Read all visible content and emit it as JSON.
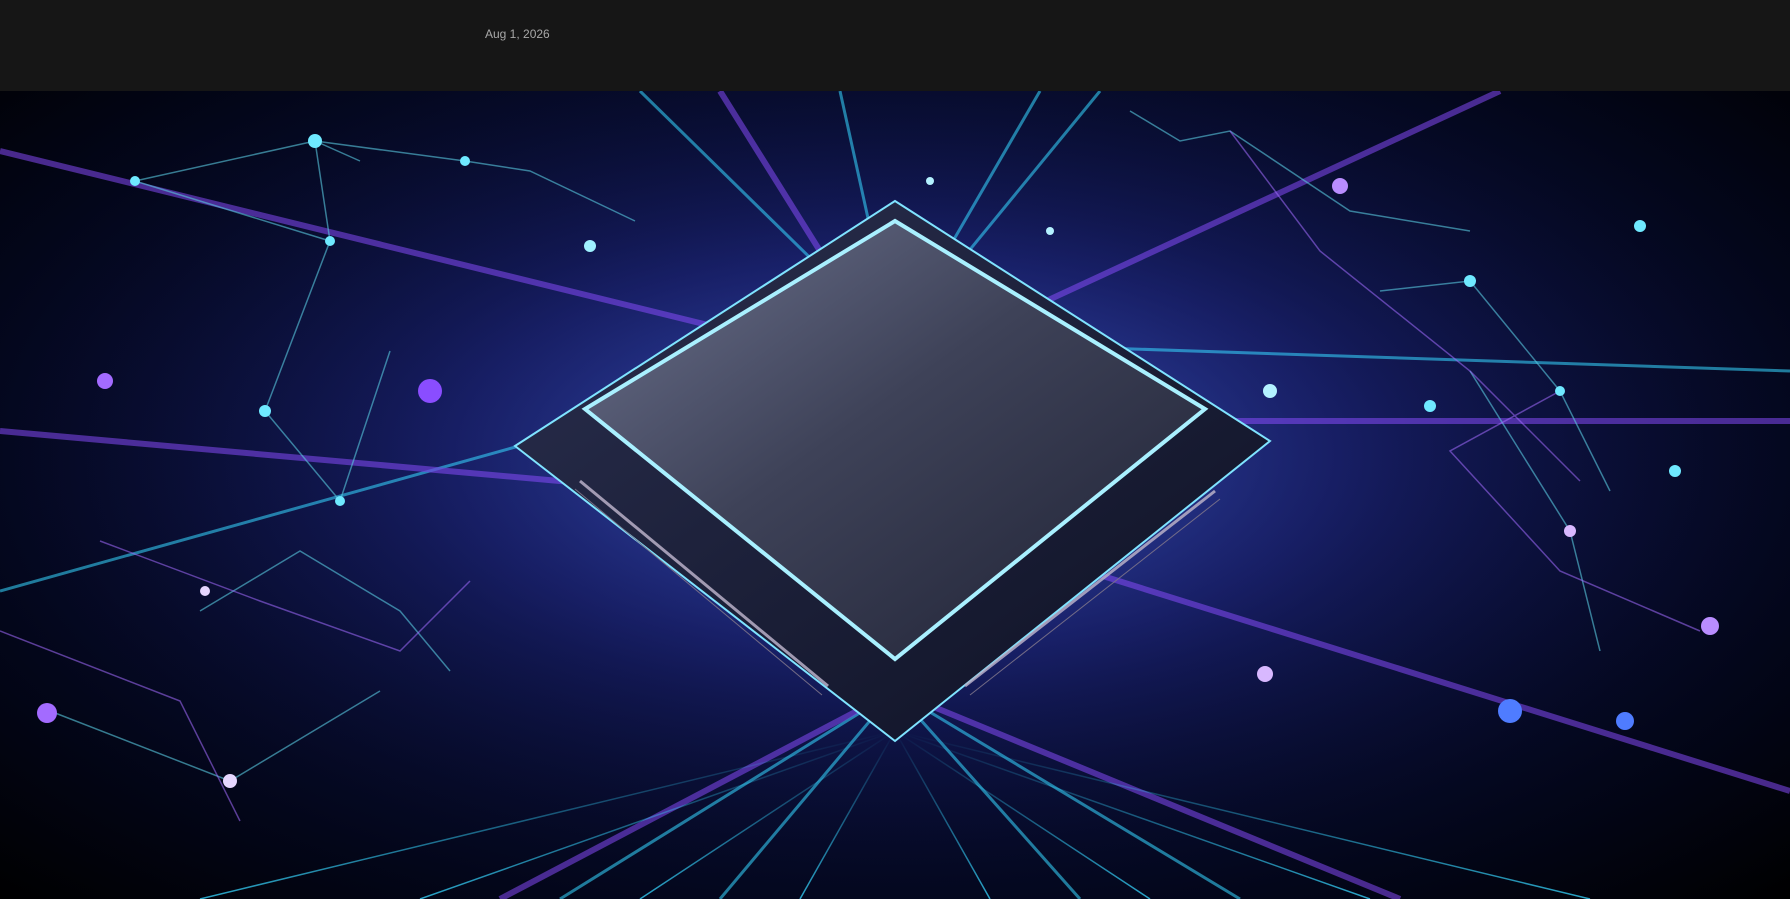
{
  "header": {
    "date": "Aug 1, 2026"
  },
  "hero": {
    "alt_icon": "processor-chip-illustration",
    "colors": {
      "background": "#161616",
      "cyan": "#37d6ff",
      "violet": "#8a4dff",
      "chip_face": "#4a5068"
    }
  }
}
